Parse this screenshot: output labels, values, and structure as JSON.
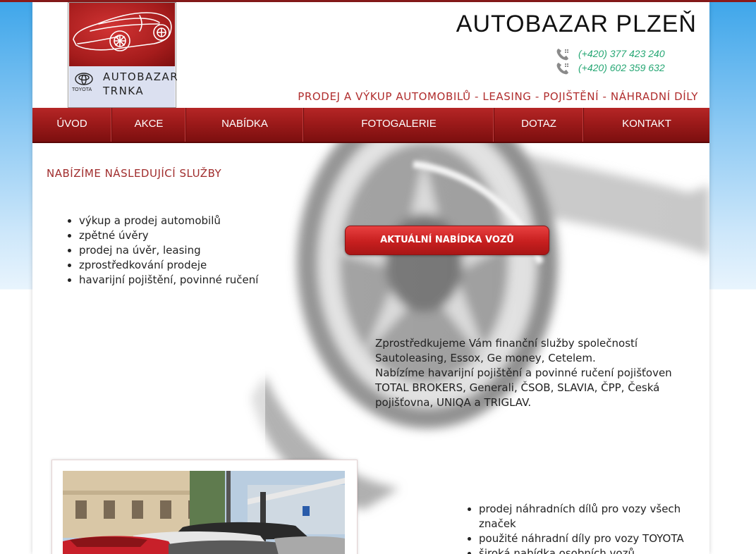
{
  "logo": {
    "line1": "AUTOBAZAR",
    "line2": "TRNKA",
    "brand": "TOYOTA",
    "icons": [
      "car-outline-icon",
      "toyota-emblem-icon"
    ]
  },
  "header": {
    "title": "AUTOBAZAR PLZEŇ",
    "phones": [
      "(+420) 377 423 240",
      "(+420) 602 359 632"
    ],
    "tagline": "PRODEJ A VÝKUP AUTOMOBILŮ - LEASING - POJIŠTĚNÍ - NÁHRADNÍ DÍLY"
  },
  "nav": {
    "items": [
      {
        "label": "ÚVOD"
      },
      {
        "label": "AKCE"
      },
      {
        "label": "NABÍDKA"
      },
      {
        "label": "FOTOGALERIE"
      },
      {
        "label": "DOTAZ"
      },
      {
        "label": "KONTAKT"
      }
    ]
  },
  "main": {
    "section_title": "NABÍZÍME NÁSLEDUJÍCÍ SLUŽBY",
    "services": [
      "výkup a prodej automobilů",
      "zpětné úvěry",
      "prodej na úvěr, leasing",
      "zprostředkování prodeje",
      "havarijní pojištění, povinné ručení"
    ],
    "cta_label": "AKTUÁLNÍ NABÍDKA VOZŮ",
    "finance_p1": "Zprostředkujeme Vám finanční služby společností Sautoleasing, Essox, Ge money, Cetelem.",
    "finance_p2": "Nabízíme havarijní pojištění a povinné ručení pojišťoven TOTAL BROKERS, Generali, ČSOB, SLAVIA, ČPP, Česká pojišťovna, UNIQA a TRIGLAV.",
    "parts": [
      "prodej náhradních dílů pro vozy všech značek",
      "použité náhradní díly pro vozy TOYOTA",
      "široká nabídka osobních vozů"
    ]
  },
  "colors": {
    "brand_red": "#a51c1c",
    "nav_red": "#9c1a1a",
    "phone_green": "#26a774",
    "tagline_red": "#b02d2d",
    "sky_blue": "#3ea6ea"
  }
}
